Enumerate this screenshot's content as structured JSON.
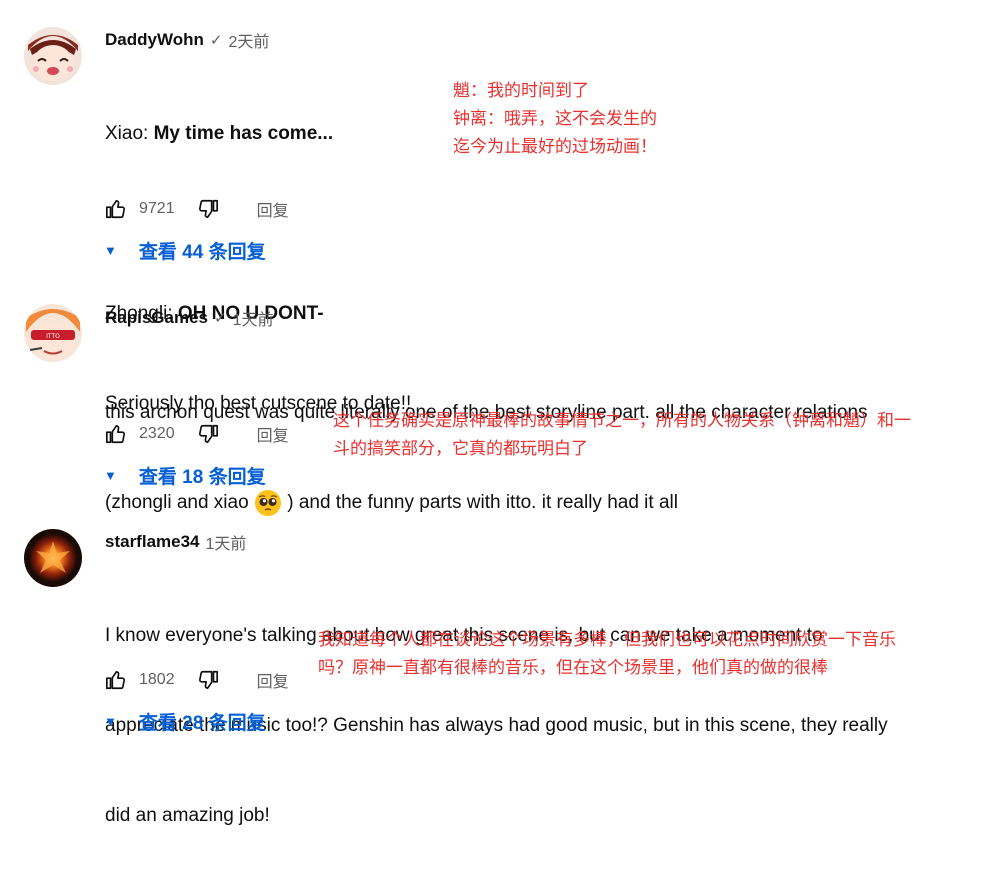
{
  "comments": [
    {
      "author": "DaddyWohn",
      "verified": "✓",
      "time": "2天前",
      "line1_speaker": "Xiao: ",
      "line1_bold": "My time has come...",
      "line2_speaker": "Zhongli: ",
      "line2_bold": "OH NO U DONT-",
      "line3": "Seriously tho best cutscene to date!!",
      "likes": "9721",
      "reply_label": "回复",
      "view_replies": "查看 44 条回复",
      "annotation": [
        "魈：我的时间到了",
        "钟离：哦弄，这不会发生的",
        "迄今为止最好的过场动画！"
      ]
    },
    {
      "author": "RapisGames",
      "verified": "✓",
      "time": "1天前",
      "line1": "this archon quest was quite literally one of the best storyline part. all the character relations",
      "line2a": "(zhongli and xiao ",
      "line2b": " ) and the funny parts with itto. it really had it all",
      "likes": "2320",
      "reply_label": "回复",
      "view_replies": "查看 18 条回复",
      "annotation": [
        "这个任务确实是原神最棒的故事情节之一，所有的人物关系（钟离和魈）和一",
        "斗的搞笑部分，它真的都玩明白了"
      ]
    },
    {
      "author": "starflame34",
      "time": "1天前",
      "line1": "I know everyone's talking about how great this scene is, but can we take a moment to",
      "line2": "appreciate the music too!? Genshin has always had good music, but in this scene, they really",
      "line3": "did an amazing job!",
      "likes": "1802",
      "reply_label": "回复",
      "view_replies": "查看 28 条回复",
      "annotation": [
        "我知道每个人都在谈论这个场景有多棒，但我们也可以花点时间欣赏一下音乐",
        "吗？原神一直都有很棒的音乐，但在这个场景里，他们真的做的很棒"
      ]
    }
  ],
  "icons": {
    "like": "thumbs-up-icon",
    "dislike": "thumbs-down-icon",
    "expand": "caret-down-icon",
    "emoji": "pleading-face-emoji"
  },
  "colors": {
    "link_blue": "#065fd4",
    "annotation_red": "#e8302f",
    "secondary_text": "#606060"
  }
}
